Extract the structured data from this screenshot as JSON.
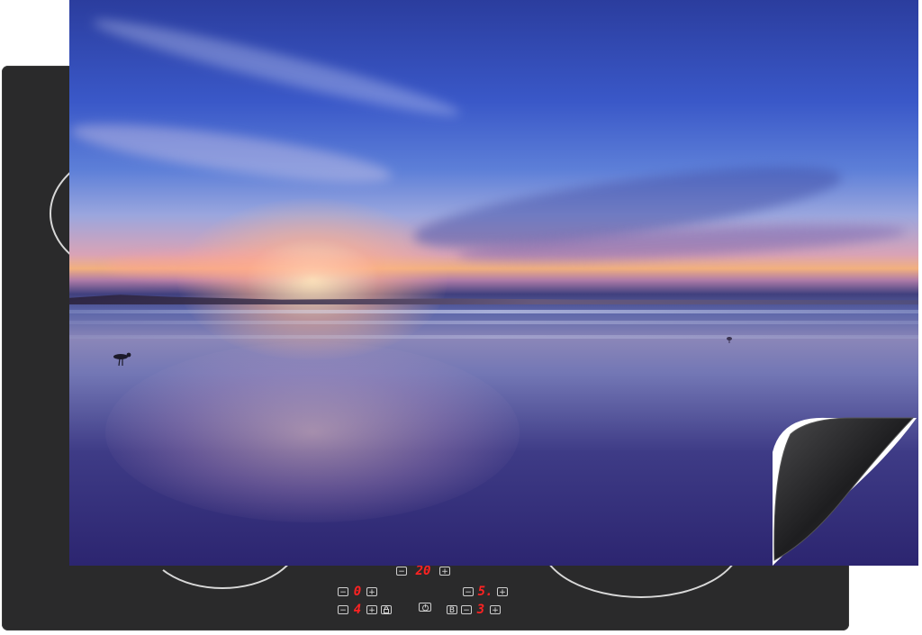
{
  "product": {
    "description_icon": "induction-hob-protector-mat"
  },
  "control_panel": {
    "top_row": {
      "timer_value": "20"
    },
    "zone_left_top": {
      "value": "0"
    },
    "zone_left_bottom": {
      "value": "4"
    },
    "zone_right_top": {
      "value": "5."
    },
    "zone_right_bottom": {
      "value": "3"
    },
    "minus_symbol": "−",
    "plus_symbol": "+",
    "lock_icon": "lock-icon",
    "power_icon": "power-icon",
    "boost_label": "B"
  },
  "colors": {
    "cooktop": "#2a2a2b",
    "display_digits": "#ff2222",
    "burner_ring": "#d8d8d8"
  }
}
